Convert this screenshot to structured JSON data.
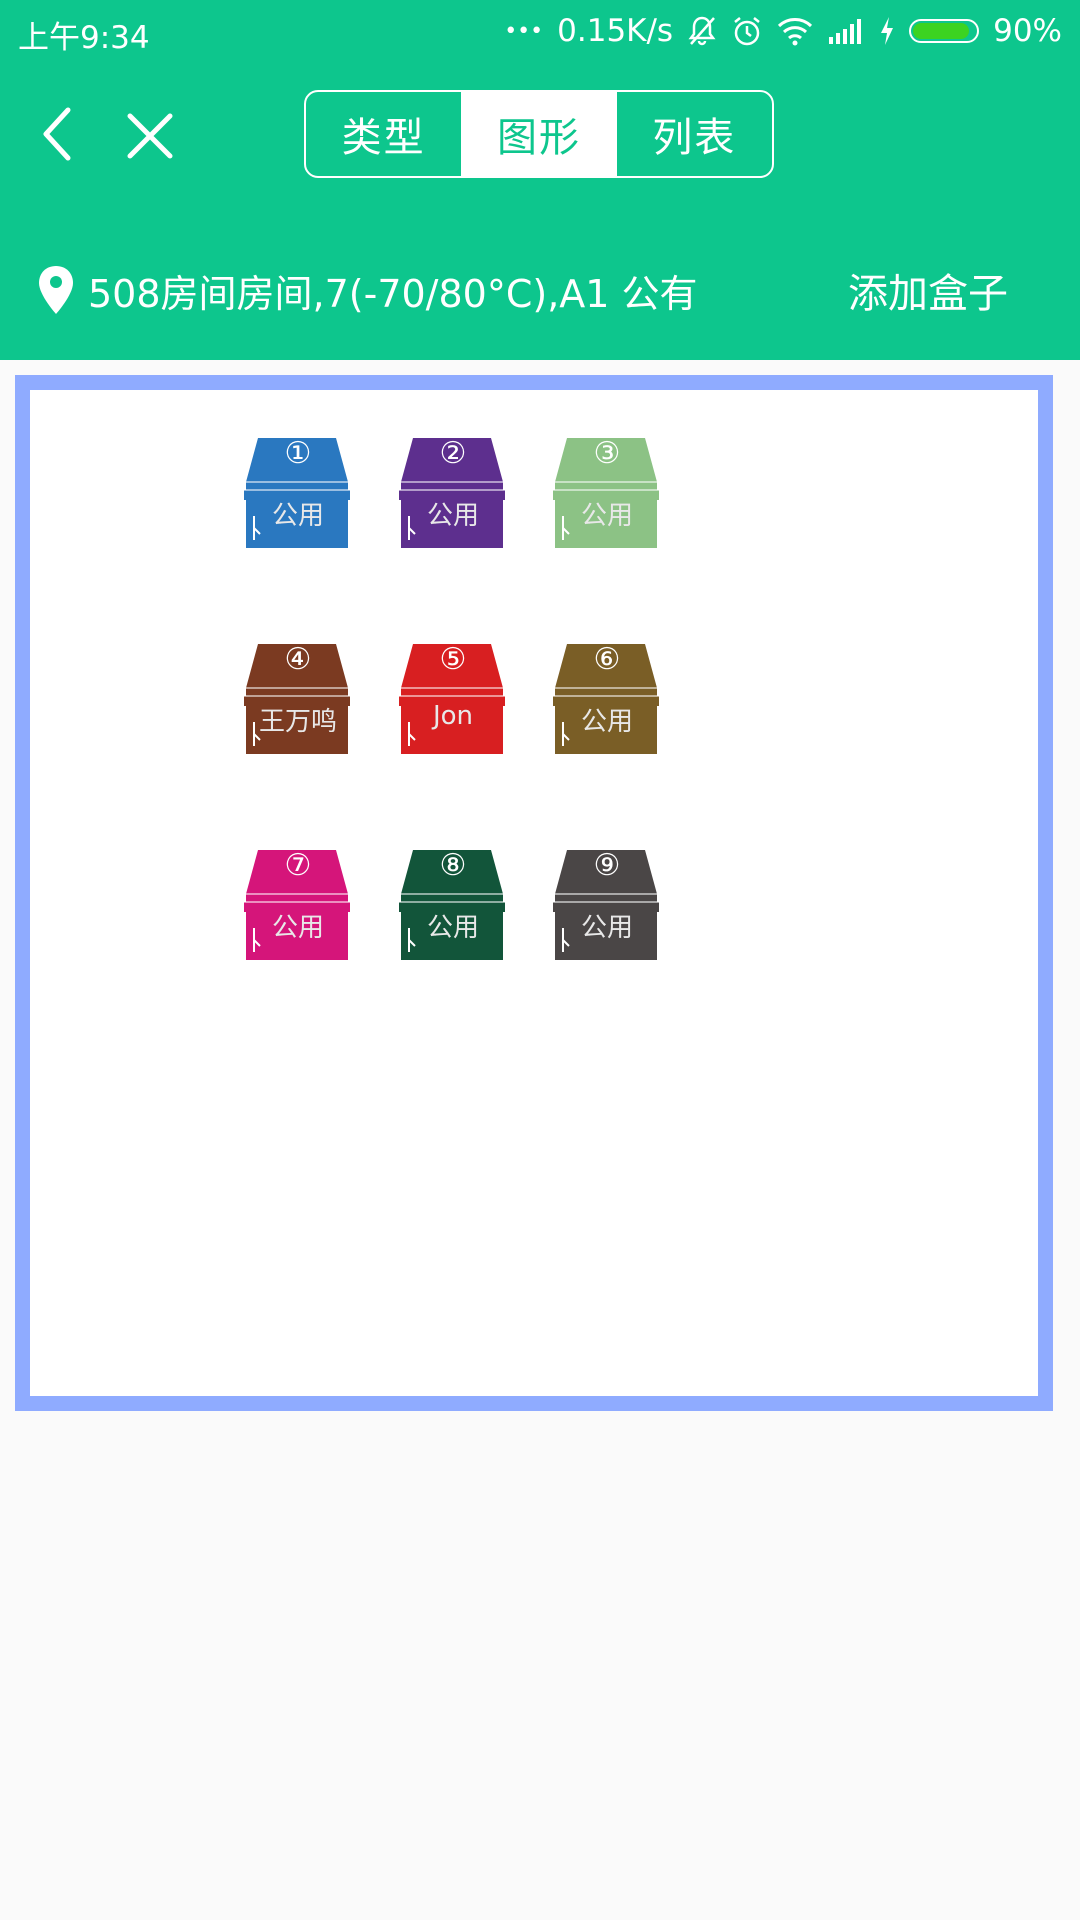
{
  "status_bar": {
    "time": "上午9:34",
    "dots": "•••",
    "speed": "0.15K/s",
    "battery": "90%",
    "battery_level": 0.9,
    "battery_color": "#3cd321"
  },
  "colors": {
    "primary": "#0dc68d",
    "panel_border": "#8fabff"
  },
  "toolbar": {
    "back_icon": "chevron-left-icon",
    "close_icon": "close-icon",
    "tabs": [
      {
        "label": "类型",
        "active": false
      },
      {
        "label": "图形",
        "active": true
      },
      {
        "label": "列表",
        "active": false
      }
    ]
  },
  "location": {
    "icon": "map-pin-icon",
    "text": "508房间房间,7(-70/80°C),A1 公有",
    "add_button": "添加盒子"
  },
  "boxes": [
    {
      "number": "①",
      "owner": "公用",
      "color": "#2a78c0"
    },
    {
      "number": "②",
      "owner": "公用",
      "color": "#5d2f8e"
    },
    {
      "number": "③",
      "owner": "公用",
      "color": "#8cc285"
    },
    {
      "number": "④",
      "owner": "王万鸣",
      "color": "#7b3a21"
    },
    {
      "number": "⑤",
      "owner": "Jon",
      "color": "#d81f21"
    },
    {
      "number": "⑥",
      "owner": "公用",
      "color": "#7a5e26"
    },
    {
      "number": "⑦",
      "owner": "公用",
      "color": "#d5157a"
    },
    {
      "number": "⑧",
      "owner": "公用",
      "color": "#12553a"
    },
    {
      "number": "⑨",
      "owner": "公用",
      "color": "#4a4646"
    }
  ]
}
